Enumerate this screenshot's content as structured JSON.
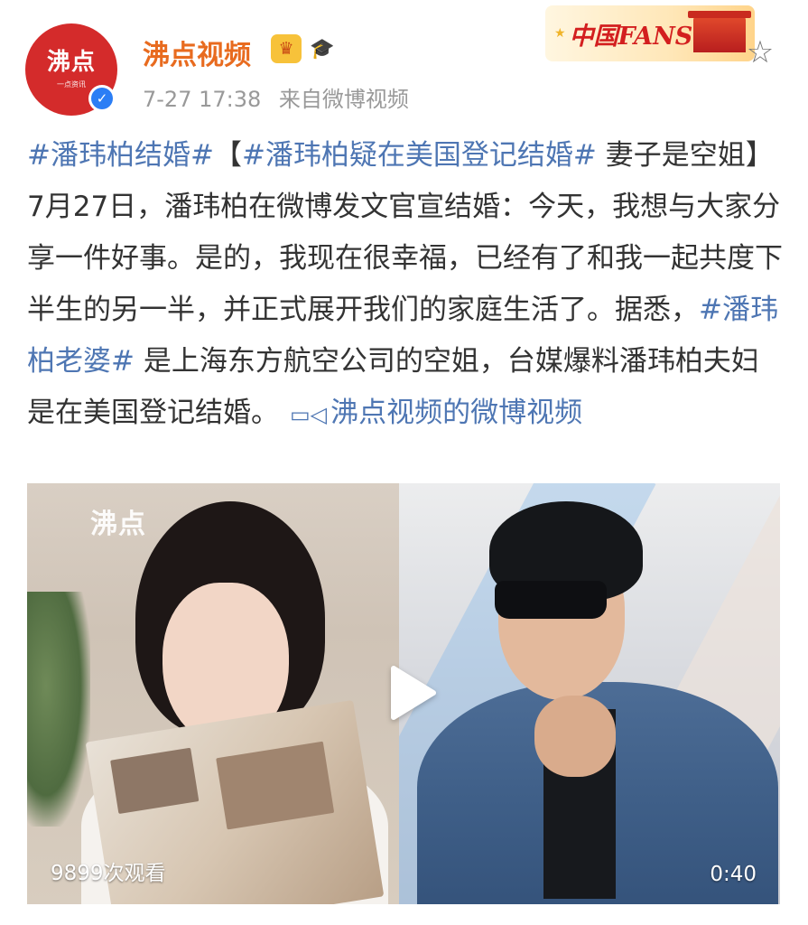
{
  "author": {
    "avatar_logo": "沸点",
    "avatar_sub": "一点资讯",
    "verified_icon": "✓",
    "name": "沸点视频",
    "crown_badge_icon": "crown-icon",
    "cap_badge_icon": "graduation-cap-icon",
    "date": "7-27 17:38",
    "source": "来自微博视频"
  },
  "banner": {
    "text": "中国FANS",
    "colors": {
      "text": "#d31f1f",
      "background": "#ffe7b8"
    }
  },
  "post": {
    "segments": [
      {
        "type": "topic",
        "text": "#潘玮柏结婚#"
      },
      {
        "type": "text",
        "text": "【"
      },
      {
        "type": "topic",
        "text": "#潘玮柏疑在美国登记结婚#"
      },
      {
        "type": "text",
        "text": " 妻子是空姐】7月27日，潘玮柏在微博发文官宣结婚：今天，我想与大家分享一件好事。是的，我现在很幸福，已经有了和我一起共度下半生的另一半，并正式展开我们的家庭生活了。据悉，"
      },
      {
        "type": "topic",
        "text": "#潘玮柏老婆#"
      },
      {
        "type": "text",
        "text": " 是上海东方航空公司的空姐，台媒爆料潘玮柏夫妇是在美国登记结婚。"
      }
    ],
    "video_link": "沸点视频的微博视频",
    "colors": {
      "link": "#4e76b3",
      "text": "#333333"
    }
  },
  "video": {
    "watermark": "沸点",
    "views": "9899次观看",
    "duration": "0:40"
  },
  "colors": {
    "username": "#e86b1f",
    "meta": "#999999",
    "verified": "#2b7ef5",
    "avatar_bg": "#d42b2b"
  }
}
